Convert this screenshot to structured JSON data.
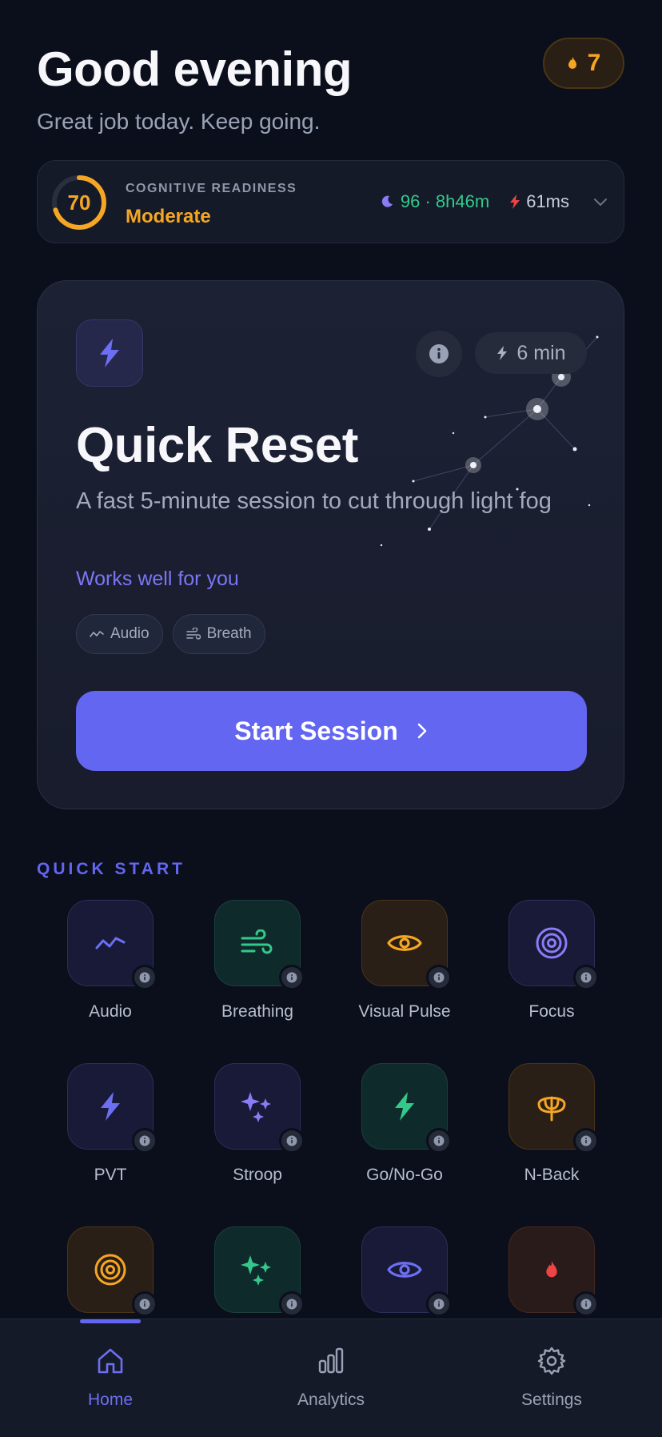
{
  "header": {
    "greeting": "Good evening",
    "subtitle": "Great job today. Keep going.",
    "streak": {
      "icon": "flame-icon",
      "count": "7"
    }
  },
  "readiness": {
    "score": "70",
    "score_fraction": 0.7,
    "label": "COGNITIVE READINESS",
    "level": "Moderate",
    "sleep": "96 · 8h46m",
    "reaction": "61ms"
  },
  "hero": {
    "duration": "6 min",
    "title": "Quick Reset",
    "description": "A fast 5-minute session to cut through light fog",
    "note": "Works well for you",
    "tags": [
      "Audio",
      "Breath"
    ],
    "start_label": "Start Session"
  },
  "quick_start": {
    "title": "QUICK START",
    "tiles": [
      {
        "label": "Audio",
        "icon": "wave-icon",
        "tone": "indigo"
      },
      {
        "label": "Breathing",
        "icon": "wind-icon",
        "tone": "teal"
      },
      {
        "label": "Visual Pulse",
        "icon": "eye-icon",
        "tone": "amber"
      },
      {
        "label": "Focus",
        "icon": "target-icon",
        "tone": "indigo"
      },
      {
        "label": "PVT",
        "icon": "bolt-icon",
        "tone": "indigo"
      },
      {
        "label": "Stroop",
        "icon": "sparkle-icon",
        "tone": "indigo"
      },
      {
        "label": "Go/No-Go",
        "icon": "bolt-icon",
        "tone": "teal"
      },
      {
        "label": "N-Back",
        "icon": "brain-icon",
        "tone": "amber"
      },
      {
        "label": "",
        "icon": "target-icon",
        "tone": "amber"
      },
      {
        "label": "",
        "icon": "sparkle-icon",
        "tone": "teal"
      },
      {
        "label": "",
        "icon": "eye-icon",
        "tone": "indigo"
      },
      {
        "label": "",
        "icon": "flame-icon",
        "tone": "red"
      }
    ]
  },
  "nav": {
    "home": "Home",
    "analytics": "Analytics",
    "settings": "Settings"
  },
  "colors": {
    "background": "#0b0f1b",
    "accent": "#6366f1",
    "amber": "#f5a623",
    "green": "#34c98b",
    "red": "#ef4444"
  }
}
